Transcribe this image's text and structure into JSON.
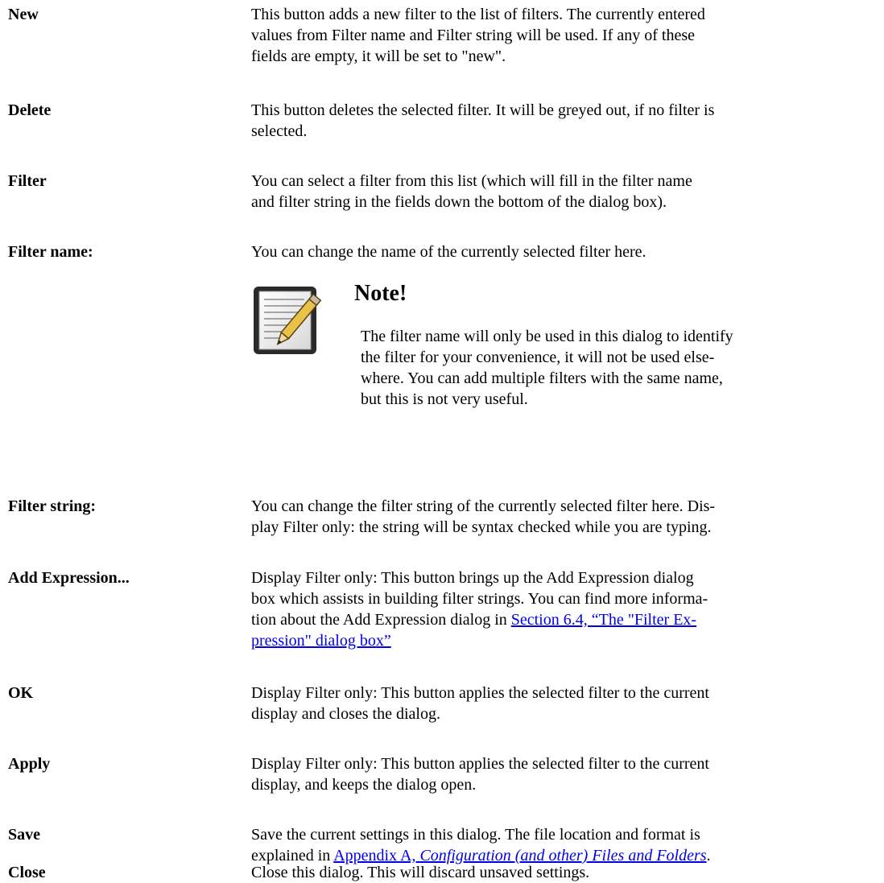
{
  "entries": {
    "new": {
      "term": "New",
      "lines": [
        "This button adds a new filter to the list of filters. The currently entered",
        "values from Filter name and Filter string will be used. If any of these",
        "fields are empty, it will be set to \"new\"."
      ]
    },
    "delete": {
      "term": "Delete",
      "lines": [
        "This button deletes the selected filter. It will be greyed out, if no filter is",
        "selected."
      ]
    },
    "filter": {
      "term": "Filter",
      "lines": [
        "You can select a filter from this list (which will fill in the filter name",
        "and filter string in the fields down the bottom of the dialog box)."
      ]
    },
    "filter_name": {
      "term": "Filter name:",
      "lines": [
        "You can change the name of the currently selected filter here."
      ]
    },
    "filter_string": {
      "term": "Filter string:",
      "lines": [
        "You can change the filter string of the currently selected filter here. Dis-",
        "play Filter only: the string will be syntax checked while you are typing."
      ]
    },
    "add_expression": {
      "term": "Add Expression...",
      "lines": [
        "Display Filter only: This button brings up the Add Expression dialog",
        "box which assists in building filter strings. You can find more informa-",
        "tion about the Add Expression dialog in"
      ],
      "link_line1": "Section 6.4, “The \"Filter Ex-",
      "link_line2": "pression\" dialog box”"
    },
    "ok": {
      "term": "OK",
      "lines": [
        "Display Filter only: This button applies the selected filter to the current",
        "display and closes the dialog."
      ]
    },
    "apply": {
      "term": "Apply",
      "lines": [
        "Display Filter only: This button applies the selected filter to the current",
        "display, and keeps the dialog open."
      ]
    },
    "save": {
      "term": "Save",
      "lines": [
        "Save the current settings in this dialog. The file location and format is",
        "explained in"
      ],
      "link_prefix": "Appendix A, ",
      "link_title": "Configuration (and other) Files and Folders",
      "suffix": "."
    },
    "close": {
      "term": "Close",
      "lines": [
        "Close this dialog. This will discard unsaved settings."
      ]
    }
  },
  "note": {
    "title": "Note!",
    "lines": [
      "The filter name will only be used in this dialog to identify",
      "the filter for your convenience, it will not be used else-",
      "where. You can add multiple filters with the same name,",
      "but this is not very useful."
    ],
    "icon": "note-pencil-icon"
  },
  "colors": {
    "text": "#000000",
    "link": "#0000ee",
    "background": "#ffffff"
  }
}
